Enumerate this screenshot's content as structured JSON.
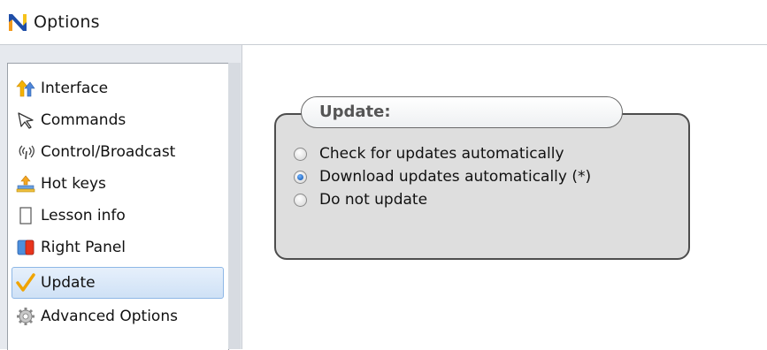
{
  "window": {
    "title": "Options",
    "logo_icon": "nc-logo-icon"
  },
  "sidebar": {
    "items": [
      {
        "label": "Interface",
        "icon": "arrows-icon",
        "selected": false
      },
      {
        "label": "Commands",
        "icon": "cursor-icon",
        "selected": false
      },
      {
        "label": "Control/Broadcast",
        "icon": "broadcast-icon",
        "selected": false
      },
      {
        "label": "Hot keys",
        "icon": "hotkeys-icon",
        "selected": false
      },
      {
        "label": "Lesson info",
        "icon": "page-icon",
        "selected": false
      },
      {
        "label": "Right Panel",
        "icon": "panel-icon",
        "selected": false
      },
      {
        "label": "Update",
        "icon": "checkmark-icon",
        "selected": true
      },
      {
        "label": "Advanced Options",
        "icon": "gear-icon",
        "selected": false
      }
    ]
  },
  "update_group": {
    "title": "Update:",
    "options": [
      {
        "label": "Check for updates automatically",
        "checked": false
      },
      {
        "label": "Download updates automatically (*)",
        "checked": true
      },
      {
        "label": "Do not update",
        "checked": false
      }
    ]
  },
  "colors": {
    "selection": "#cfe1f6",
    "selection_border": "#8eb7e6",
    "group_bg": "#dedede",
    "accent_radio": "#0a4fa8"
  }
}
